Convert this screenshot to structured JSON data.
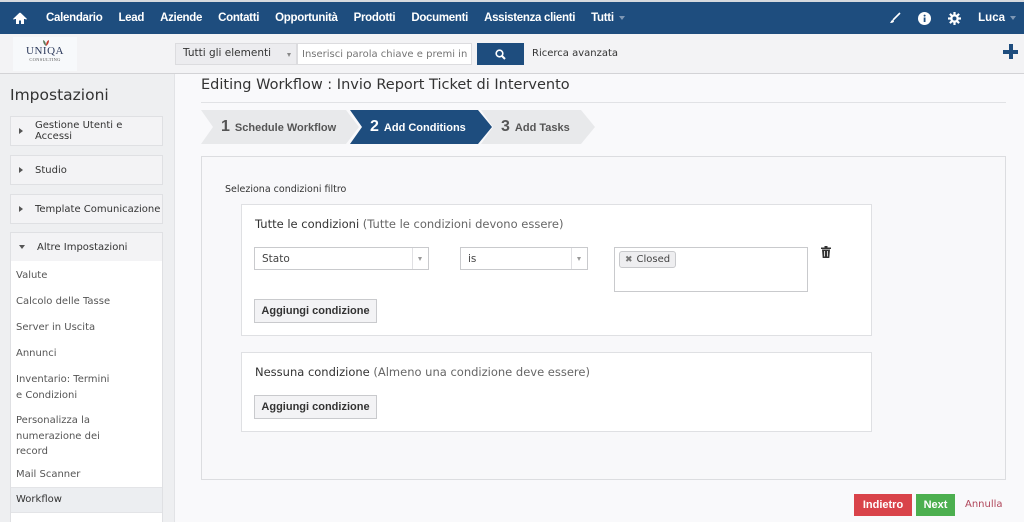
{
  "topnav": {
    "home_icon": "home-icon",
    "items": [
      "Calendario",
      "Lead",
      "Aziende",
      "Contatti",
      "Opportunità",
      "Prodotti",
      "Documenti",
      "Assistenza clienti",
      "Tutti"
    ],
    "right_icons": [
      "brush-icon",
      "info-icon",
      "gear-icon"
    ],
    "user": "Luca"
  },
  "subbar": {
    "logo_text": "UNIQA",
    "logo_subtext": "CONSULTING",
    "search_scope": "Tutti gli elementi",
    "search_placeholder": "Inserisci parola chiave e premi invio",
    "search_icon": "search-icon",
    "advanced_search": "Ricerca avanzata",
    "add_icon": "plus-icon"
  },
  "sidebar": {
    "title": "Impostazioni",
    "sections": [
      {
        "label": "Gestione Utenti e Accessi",
        "expanded": false
      },
      {
        "label": "Studio",
        "expanded": false
      },
      {
        "label": "Template Comunicazione",
        "expanded": false
      },
      {
        "label": "Altre Impostazioni",
        "expanded": true
      }
    ],
    "items": [
      "Valute",
      "Calcolo delle Tasse",
      "Server in Uscita",
      "Annunci",
      "Inventario: Termini e Condizioni",
      "Personalizza la numerazione dei record",
      "Mail Scanner",
      "Workflow"
    ],
    "active_item": "Workflow"
  },
  "main": {
    "title": "Editing Workflow : Invio Report Ticket di Intervento",
    "steps": [
      {
        "num": "1",
        "label": "Schedule Workflow",
        "active": false
      },
      {
        "num": "2",
        "label": "Add Conditions",
        "active": true
      },
      {
        "num": "3",
        "label": "Add Tasks",
        "active": false
      }
    ],
    "filter_label": "Seleziona condizioni filtro",
    "all_conditions": {
      "title": "Tutte le condizioni",
      "note": "(Tutte le condizioni devono essere)",
      "rows": [
        {
          "field": "Stato",
          "operator": "is",
          "values": [
            "Closed"
          ]
        }
      ],
      "add_button": "Aggiungi condizione"
    },
    "any_conditions": {
      "title": "Nessuna condizione",
      "note": "(Almeno una condizione deve essere)",
      "add_button": "Aggiungi condizione"
    },
    "buttons": {
      "back": "Indietro",
      "next": "Next",
      "cancel": "Annulla"
    }
  },
  "colors": {
    "brand": "#1e4d7e",
    "back_button": "#d9434a",
    "next_button": "#4caf4f",
    "cancel_link": "#b0465a"
  }
}
